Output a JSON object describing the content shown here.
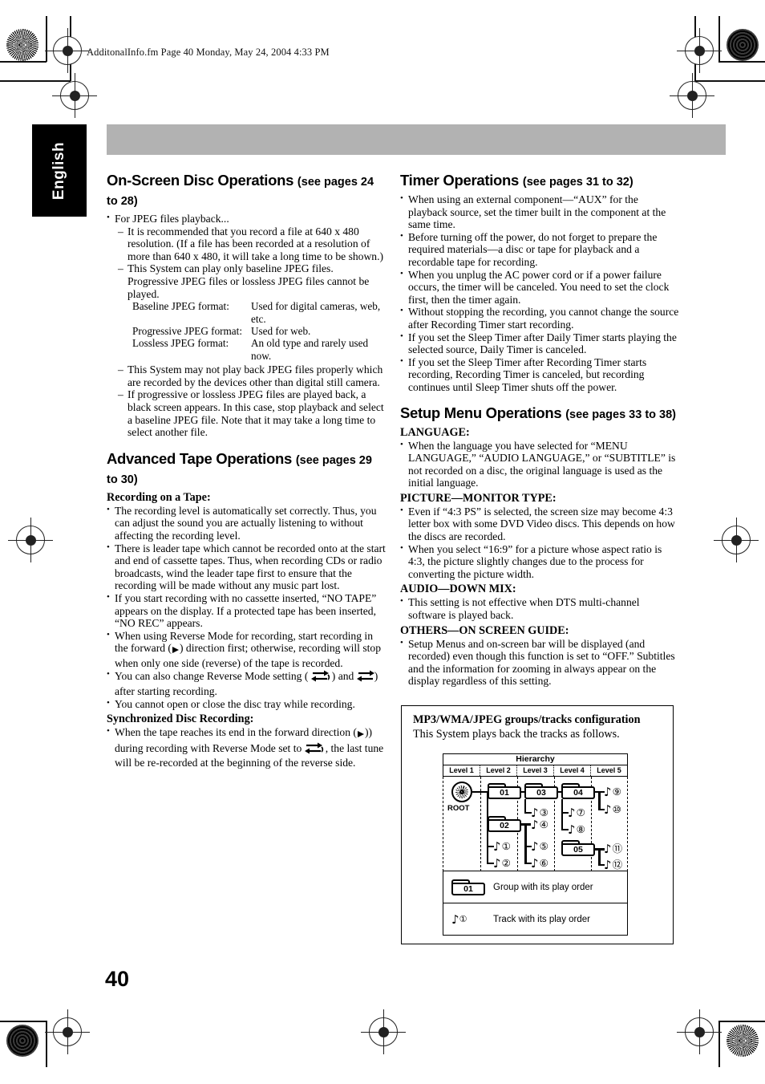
{
  "header": {
    "file_line": "AdditonalInfo.fm  Page 40  Monday, May 24, 2004  4:33 PM"
  },
  "side_tab": {
    "label": "English"
  },
  "page_number": "40",
  "left_column": {
    "section1": {
      "title": "On-Screen Disc Operations",
      "pages": "(see pages 24 to 28)",
      "bullet_intro": "For JPEG files playback...",
      "dashes": [
        "It is recommended that you record a file at 640 x 480 resolution. (If a file has been recorded at a resolution of more than 640 x 480, it will take a long time to be shown.)",
        "This System can play only baseline JPEG files. Progressive JPEG files or lossless JPEG files cannot be played.",
        "This System may not play back JPEG files properly which are recorded by the devices other than digital still camera.",
        "If progressive or lossless JPEG files are played back, a black screen appears. In this case, stop playback and select a baseline JPEG file. Note that it may take a long time to select another file."
      ],
      "formats": [
        {
          "name": "Baseline JPEG format:",
          "desc": "Used for digital cameras, web, etc."
        },
        {
          "name": "Progressive JPEG format:",
          "desc": "Used for web."
        },
        {
          "name": "Lossless JPEG format:",
          "desc": "An old type and rarely used now."
        }
      ]
    },
    "section2": {
      "title": "Advanced Tape Operations",
      "pages": "(see pages 29 to 30)",
      "sub1_title": "Recording on a Tape:",
      "sub1_bullets": [
        "The recording level is automatically set correctly. Thus, you can adjust the sound you are actually listening to without affecting the recording level.",
        "There is leader tape which cannot be recorded onto at the start and end of cassette tapes. Thus, when recording CDs or radio broadcasts, wind the leader tape first to ensure that the recording will be made without any music part lost.",
        "If you start recording with no cassette inserted, “NO TAPE” appears on the display. If a protected tape has been inserted, “NO REC” appears.",
        "You cannot open or close the disc tray while recording."
      ],
      "bullet_reverse_mode": {
        "part1": "When using Reverse Mode for recording, start recording in the forward (",
        "part2": ") direction first; otherwise, recording will stop when only one side (reverse) of the tape is recorded."
      },
      "bullet_change_setting": {
        "part1": "You can also change Reverse Mode setting (",
        "part2": ") and",
        "part3": ") after starting recording."
      },
      "sub2_title": "Synchronized Disc Recording:",
      "sub2_bullet": {
        "part1": "When the tape reaches its end in the forward direction (",
        "part2": ") during recording with Reverse Mode set to",
        "part3": ", the last tune will be re-recorded at the beginning of the reverse side."
      }
    }
  },
  "right_column": {
    "section1": {
      "title": "Timer Operations",
      "pages": "(see pages 31 to 32)",
      "bullets": [
        "When using an external component—“AUX” for the playback source, set the timer built in the component at the same time.",
        "Before turning off the power, do not forget to prepare the required materials—a disc or tape for playback and a recordable tape for recording.",
        "When you unplug the AC power cord or if a power failure occurs, the timer will be canceled. You need to set the clock first, then the timer again.",
        "Without stopping the recording, you cannot change the source after Recording Timer start recording.",
        " If you set the Sleep Timer after Daily Timer starts playing the selected source, Daily Timer is canceled.",
        "If you set the Sleep Timer after Recording Timer starts recording, Recording Timer is canceled, but recording continues until Sleep Timer shuts off the power."
      ]
    },
    "section2": {
      "title": "Setup Menu Operations",
      "pages": "(see pages 33 to 38)",
      "groups": [
        {
          "heading": "LANGUAGE:",
          "bullets": [
            "When the language you have selected for “MENU LANGUAGE,” “AUDIO LANGUAGE,” or “SUBTITLE” is not recorded on a disc, the original language is used as the initial language."
          ]
        },
        {
          "heading": "PICTURE—MONITOR TYPE:",
          "bullets": [
            "Even if “4:3 PS” is selected, the screen size may become 4:3 letter box with some DVD Video discs. This depends on how the discs are recorded.",
            "When you select “16:9” for a picture whose aspect ratio is 4:3, the picture slightly changes due to the process for converting the picture width."
          ]
        },
        {
          "heading": "AUDIO—DOWN MIX:",
          "bullets": [
            "This setting is not effective when DTS multi-channel software is played back."
          ]
        },
        {
          "heading": "OTHERS—ON SCREEN GUIDE:",
          "bullets": [
            "Setup Menus and on-screen bar will be displayed (and recorded) even though this function is set to “OFF.” Subtitles and the information for zooming in always appear on the display regardless of this setting."
          ]
        }
      ]
    }
  },
  "mp3_box": {
    "title": "MP3/WMA/JPEG groups/tracks configuration",
    "subtitle": "This System plays back the tracks as follows.",
    "hierarchy_label": "Hierarchy",
    "levels": [
      "Level 1",
      "Level 2",
      "Level 3",
      "Level 4",
      "Level 5"
    ],
    "root_label": "ROOT",
    "groups": [
      {
        "id": "01",
        "level": 2
      },
      {
        "id": "02",
        "level": 2
      },
      {
        "id": "03",
        "level": 3
      },
      {
        "id": "04",
        "level": 4
      },
      {
        "id": "05",
        "level": 4
      }
    ],
    "tracks": [
      {
        "order": "①",
        "level": 2
      },
      {
        "order": "②",
        "level": 2
      },
      {
        "order": "③",
        "level": 3
      },
      {
        "order": "④",
        "level": 3
      },
      {
        "order": "⑤",
        "level": 3
      },
      {
        "order": "⑥",
        "level": 3
      },
      {
        "order": "⑦",
        "level": 4
      },
      {
        "order": "⑧",
        "level": 4
      },
      {
        "order": "⑨",
        "level": 5
      },
      {
        "order": "⑩",
        "level": 5
      },
      {
        "order": "⑪",
        "level": 5
      },
      {
        "order": "⑫",
        "level": 5
      }
    ],
    "legend": [
      {
        "icon_id": "01",
        "text": "Group with its play order"
      },
      {
        "icon_id": "①",
        "text": "Track with its play order"
      }
    ]
  }
}
